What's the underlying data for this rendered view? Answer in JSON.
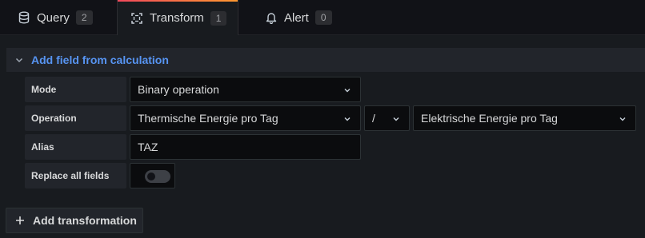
{
  "tabs": [
    {
      "label": "Query",
      "count": "2",
      "icon": "database-icon"
    },
    {
      "label": "Transform",
      "count": "1",
      "icon": "transform-icon"
    },
    {
      "label": "Alert",
      "count": "0",
      "icon": "bell-icon"
    }
  ],
  "accent_colors": {
    "link": "#5794f2",
    "tab_gradient_start": "#f2495c",
    "tab_gradient_end": "#ff9830"
  },
  "transformation": {
    "title": "Add field from calculation",
    "mode": {
      "label": "Mode",
      "value": "Binary operation"
    },
    "operation": {
      "label": "Operation",
      "left": "Thermische Energie pro Tag",
      "operator": "/",
      "right": "Elektrische Energie pro Tag"
    },
    "alias": {
      "label": "Alias",
      "value": "TAZ"
    },
    "replace_all_fields": {
      "label": "Replace all fields",
      "enabled": false
    }
  },
  "add_transformation_label": "Add transformation"
}
